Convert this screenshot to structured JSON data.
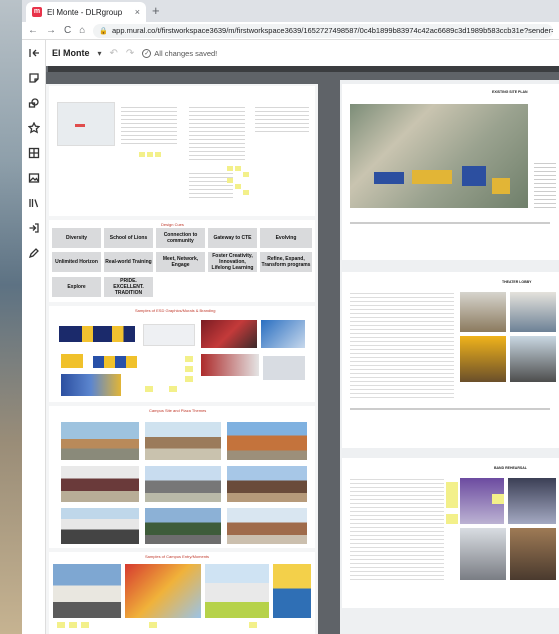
{
  "browser": {
    "tab_title": "El Monte - DLRgroup",
    "new_tab": "+",
    "close": "×",
    "url": "app.mural.co/t/firstworkspace3639/m/firstworkspace3639/1652727498587/0c4b1899b83974c42ac6689c3d1989b583ccb31e?sender=jmiller",
    "nav_back": "←",
    "nav_forward": "→",
    "nav_reload": "C",
    "nav_home": "⌂"
  },
  "app": {
    "workspace_title": "El Monte",
    "save_status": "All changes saved!"
  },
  "sidebar": {
    "tools": [
      "collapse-icon",
      "sticky-note-icon",
      "shapes-icon",
      "star-icon",
      "frame-icon",
      "image-icon",
      "library-icon",
      "import-icon",
      "pen-icon"
    ]
  },
  "board_left": {
    "design_cues_title": "Design Cues",
    "cues": [
      "Diversity",
      "School of Lions",
      "Connection to community",
      "Gateway to CTE",
      "Evolving",
      "Unlimited Horizon",
      "Real-world Training",
      "Meet, Network, Engage",
      "Foster Creativity, Innovation, Lifelong Learning",
      "Refine, Expand, Transform programs",
      "Explore",
      "PRIDE. EXCELLENT. TRADITION"
    ],
    "section_titles": [
      "Samples of ESD Graphics/Murals & Branding",
      "Campus Site and Plaza Themes",
      "Samples of Campus Entry/Moments"
    ]
  },
  "board_right": {
    "sheets": [
      "EXISTING SITE PLAN",
      "THEATER LOBBY",
      "BAND REHEARSAL"
    ]
  },
  "colors": {
    "accent": "#e8334a",
    "canvas": "#5f6368",
    "sticky": "#f3f08a"
  }
}
